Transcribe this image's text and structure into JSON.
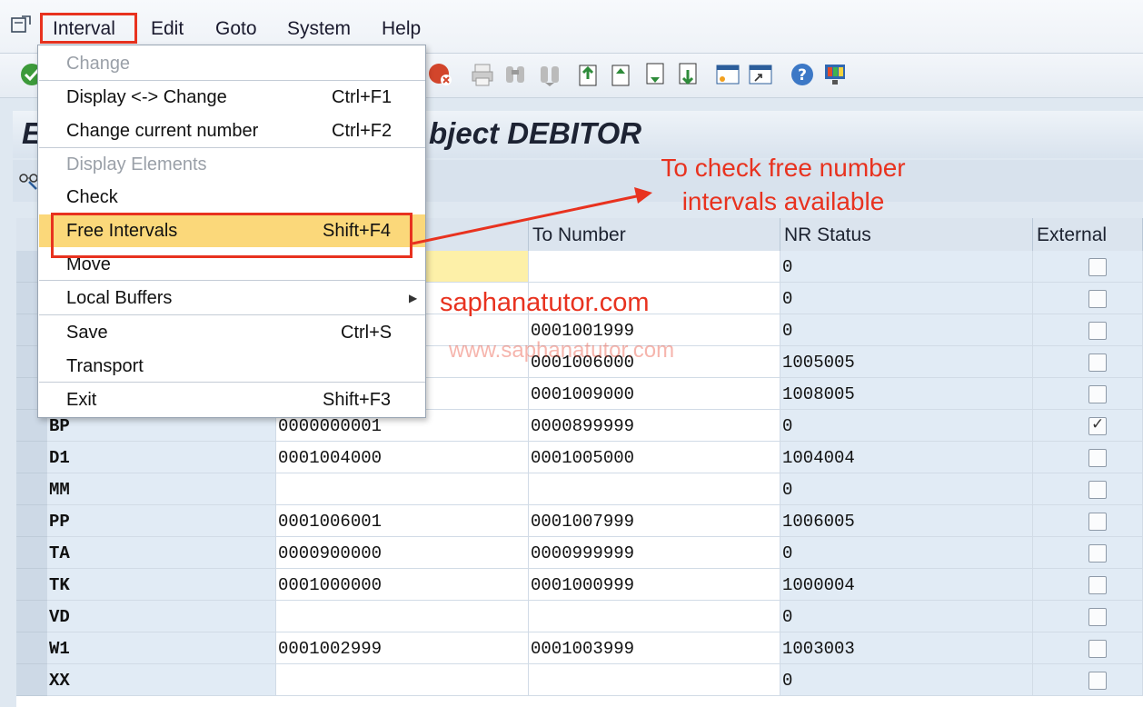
{
  "menubar": {
    "items": [
      {
        "label": "Interval",
        "u": 0
      },
      {
        "label": "Edit",
        "u": 0
      },
      {
        "label": "Goto",
        "u": 0
      },
      {
        "label": "System",
        "u": 0
      },
      {
        "label": "Help",
        "u": 0
      }
    ]
  },
  "title": {
    "left_fragment": "E",
    "right_fragment": "bject DEBITOR"
  },
  "table": {
    "headers": [
      "To Number",
      "NR Status",
      "External"
    ],
    "rows": [
      {
        "no": "",
        "from": "",
        "to": "",
        "status": "0",
        "ext": false
      },
      {
        "no": "",
        "from": "",
        "to": "",
        "status": "0",
        "ext": false
      },
      {
        "no": "",
        "from": "",
        "to": "0001001999",
        "status": "0",
        "ext": false
      },
      {
        "no": "",
        "from": "",
        "to": "0001006000",
        "status": "1005005",
        "ext": false
      },
      {
        "no": "",
        "from": "",
        "to": "0001009000",
        "status": "1008005",
        "ext": false
      },
      {
        "no": "BP",
        "from": "0000000001",
        "to": "0000899999",
        "status": "0",
        "ext": true
      },
      {
        "no": "D1",
        "from": "0001004000",
        "to": "0001005000",
        "status": "1004004",
        "ext": false
      },
      {
        "no": "MM",
        "from": "",
        "to": "",
        "status": "0",
        "ext": false
      },
      {
        "no": "PP",
        "from": "0001006001",
        "to": "0001007999",
        "status": "1006005",
        "ext": false
      },
      {
        "no": "TA",
        "from": "0000900000",
        "to": "0000999999",
        "status": "0",
        "ext": false
      },
      {
        "no": "TK",
        "from": "0001000000",
        "to": "0001000999",
        "status": "1000004",
        "ext": false
      },
      {
        "no": "VD",
        "from": "",
        "to": "",
        "status": "0",
        "ext": false
      },
      {
        "no": "W1",
        "from": "0001002999",
        "to": "0001003999",
        "status": "1003003",
        "ext": false
      },
      {
        "no": "XX",
        "from": "",
        "to": "",
        "status": "0",
        "ext": false
      }
    ]
  },
  "dropdown": {
    "change": "Change",
    "display_change": "Display <-> Change",
    "display_change_sc": "Ctrl+F1",
    "change_current": "Change current number",
    "change_current_sc": "Ctrl+F2",
    "display_elements": "Display Elements",
    "check": "Check",
    "free_intervals": "Free Intervals",
    "free_intervals_sc": "Shift+F4",
    "move": "Move",
    "local_buffers": "Local Buffers",
    "save": "Save",
    "save_sc": "Ctrl+S",
    "transport": "Transport",
    "exit": "Exit",
    "exit_sc": "Shift+F3"
  },
  "annotations": {
    "callout_line1": "To check free number",
    "callout_line2": "intervals available",
    "brand": "saphanatutor.com",
    "watermark": "www.saphanatutor.com"
  },
  "colors": {
    "highlight_red": "#e8321f",
    "menu_hover": "#fbd87a"
  },
  "icons": [
    "window-icon",
    "enter-check-icon",
    "cancel-icon",
    "print-icon",
    "find-icon",
    "find-next-icon",
    "first-page-icon",
    "previous-page-icon",
    "next-page-icon",
    "last-page-icon",
    "new-session-icon",
    "shortcut-icon",
    "help-icon",
    "customize-layout-icon",
    "glasses-icon"
  ]
}
